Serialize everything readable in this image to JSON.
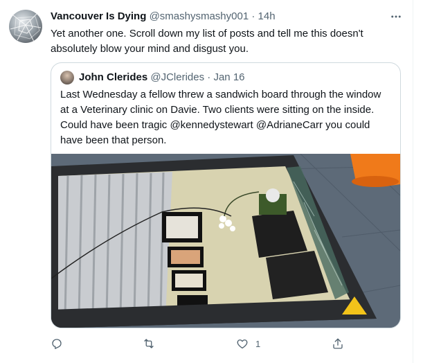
{
  "tweet": {
    "author_name": "Vancouver Is Dying",
    "author_handle": "@smashysmashy001",
    "separator": "·",
    "time": "14h",
    "text": "Yet another one. Scroll down my list of posts and tell me this doesn't absolutely blow your mind and disgust you."
  },
  "quoted": {
    "author_name": "John Clerides",
    "author_handle": "@JClerides",
    "separator": "·",
    "date": "Jan 16",
    "text": "Last Wednesday a fellow threw a sandwich board through the window at a Veterinary clinic on Davie. Two clients were sitting on the inside. Could have been tragic @kennedystewart @AdrianeCarr you could have been that person."
  },
  "actions": {
    "reply_count": "",
    "retweet_count": "",
    "like_count": "1",
    "share_count": ""
  },
  "icons": {
    "more": "more-dots-icon",
    "reply": "reply-icon",
    "retweet": "retweet-icon",
    "like": "heart-icon",
    "share": "share-icon"
  },
  "colors": {
    "text": "#0f1419",
    "muted": "#536471",
    "border": "#cfd9de"
  }
}
